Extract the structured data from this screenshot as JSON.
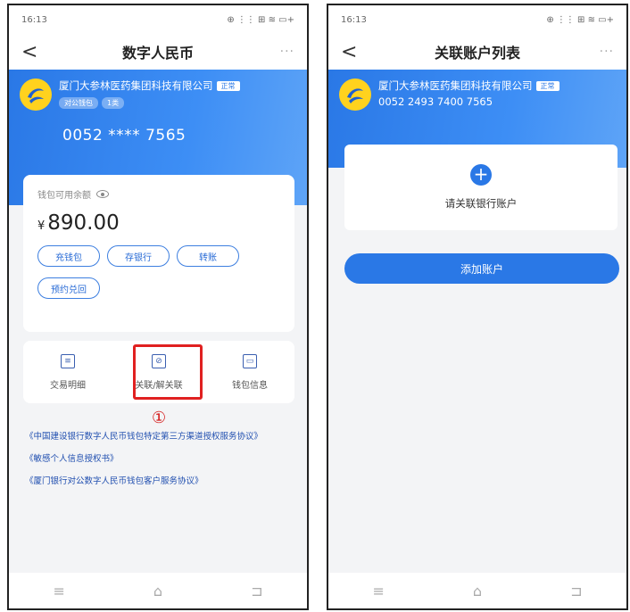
{
  "left_screen": {
    "status_time": "16:13",
    "status_right": "⊕ ⋮⋮ ⊞ ≋ ▭+",
    "nav": {
      "back": "<",
      "title": "数字人民币",
      "more": "···"
    },
    "org": {
      "name": "厦门大参林医药集团科技有限公司",
      "badge": "正常",
      "tags": [
        "对公钱包",
        "1类"
      ]
    },
    "account_masked": "0052 **** 7565",
    "balance_label": "钱包可用余额",
    "currency": "¥",
    "balance": "890.00",
    "buttons": [
      "充钱包",
      "存银行",
      "转账",
      "预约兑回"
    ],
    "actions": [
      "交易明细",
      "关联/解关联",
      "钱包信息"
    ],
    "step_marker": "①",
    "links": [
      "《中国建设银行数字人民币钱包特定第三方渠道授权服务协议》",
      "《敏感个人信息授权书》",
      "《厦门银行对公数字人民币钱包客户服务协议》"
    ],
    "bottom_nav": [
      "≡",
      "⌂",
      "⊐"
    ]
  },
  "right_screen": {
    "status_time": "16:13",
    "status_right": "⊕ ⋮⋮ ⊞ ≋ ▭+",
    "nav": {
      "back": "<",
      "title": "关联账户列表",
      "more": "···"
    },
    "org": {
      "name": "厦门大参林医药集团科技有限公司",
      "badge": "正常"
    },
    "account_full": "0052 2493 7400 7565",
    "link_card_label": "请关联银行账户",
    "add_button": "添加账户",
    "bottom_nav": [
      "≡",
      "⌂",
      "⊐"
    ]
  },
  "colors": {
    "primary": "#2a78e6",
    "highlight": "#e02020",
    "link": "#2250b0"
  }
}
